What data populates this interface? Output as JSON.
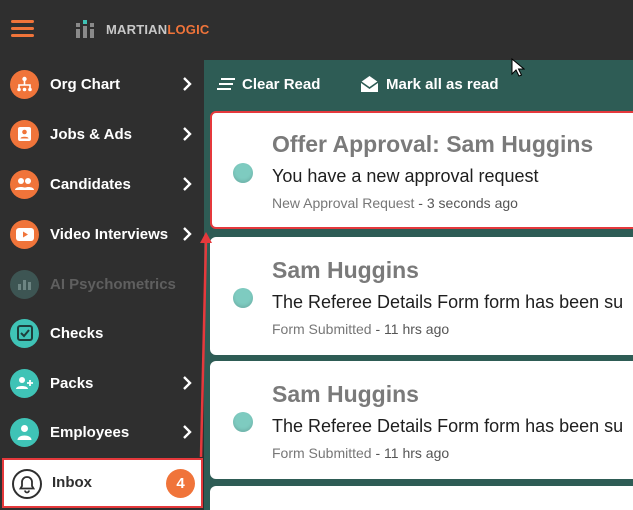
{
  "app": {
    "logo_part1": "MARTIAN",
    "logo_part2": "LOGIC",
    "accent": "#f0743a",
    "teal": "#2e5c55"
  },
  "sidebar": {
    "items": [
      {
        "label": "Org Chart",
        "icon": "org-chart-icon",
        "color": "#f0743a"
      },
      {
        "label": "Jobs & Ads",
        "icon": "jobs-icon",
        "color": "#f0743a"
      },
      {
        "label": "Candidates",
        "icon": "candidates-icon",
        "color": "#f0743a"
      },
      {
        "label": "Video Interviews",
        "icon": "video-icon",
        "color": "#f0743a"
      },
      {
        "label": "AI Psychometrics",
        "icon": "psychometrics-icon",
        "color": "#3d5553"
      },
      {
        "label": "Checks",
        "icon": "checks-icon",
        "color": "#3fc3b6"
      },
      {
        "label": "Packs",
        "icon": "packs-icon",
        "color": "#3fc3b6"
      },
      {
        "label": "Employees",
        "icon": "employees-icon",
        "color": "#3fc3b6"
      }
    ],
    "inbox": {
      "label": "Inbox",
      "badge": "4"
    }
  },
  "toolbar": {
    "clear_read": "Clear Read",
    "mark_all": "Mark all as read"
  },
  "notifications": [
    {
      "title": "Offer Approval: Sam Huggins",
      "message": "You have a new approval request",
      "type": "New Approval Request",
      "time": " - 3 seconds ago"
    },
    {
      "title": "Sam Huggins",
      "message": "The Referee Details Form form has been su",
      "type": "Form Submitted",
      "time": " - 11 hrs ago"
    },
    {
      "title": "Sam Huggins",
      "message": "The Referee Details Form form has been su",
      "type": "Form Submitted",
      "time": " - 11 hrs ago"
    }
  ]
}
